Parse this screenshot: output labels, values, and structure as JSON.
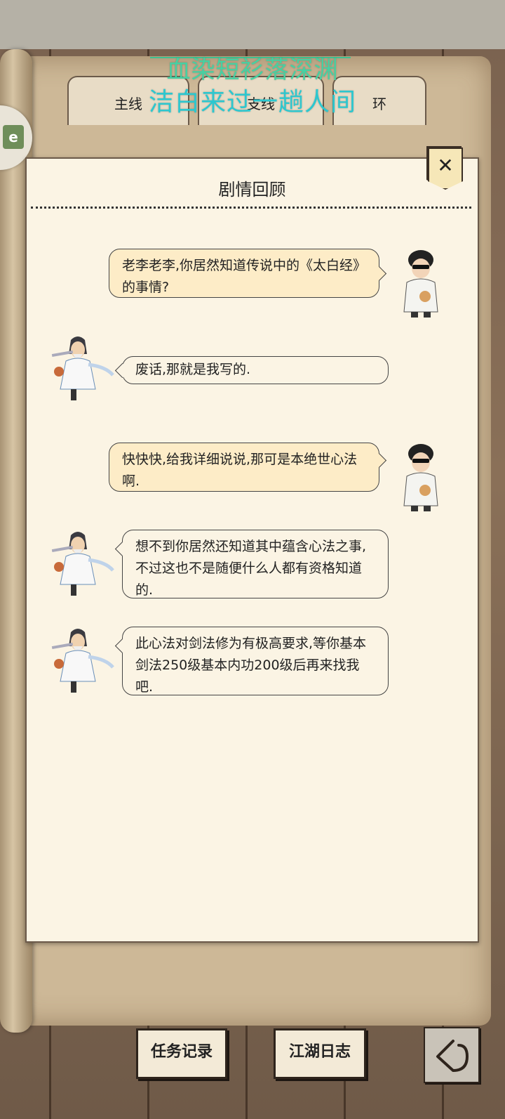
{
  "overlay": {
    "lyric_line1": "血染短衫落深渊",
    "lyric_line2": "洁白来过一趟人间"
  },
  "tabs": [
    {
      "label": "主线"
    },
    {
      "label": "支线"
    },
    {
      "label": "环"
    }
  ],
  "side_badge": {
    "text": "e"
  },
  "dialog": {
    "title": "剧情回顾",
    "close_symbol": "✕",
    "messages": [
      {
        "speaker": "player",
        "text": "老李老李,你居然知道传说中的《太白经》的事情?"
      },
      {
        "speaker": "npc",
        "text": "废话,那就是我写的."
      },
      {
        "speaker": "player",
        "text": "快快快,给我详细说说,那可是本绝世心法啊."
      },
      {
        "speaker": "npc",
        "text": "想不到你居然还知道其中蕴含心法之事,不过这也不是随便什么人都有资格知道的."
      },
      {
        "speaker": "npc",
        "text": "此心法对剑法修为有极高要求,等你基本剑法250级基本内功200级后再来找我吧."
      }
    ]
  },
  "bottom": {
    "tasks_label": "任务记录",
    "journal_label": "江湖日志"
  },
  "icons": {
    "close": "close-icon",
    "back": "back-arrow-icon"
  },
  "colors": {
    "paper": "#fbf4e4",
    "player_bubble": "#fdecc7",
    "lyric_green": "#47d0a2",
    "lyric_cyan": "#2cc7cf"
  }
}
